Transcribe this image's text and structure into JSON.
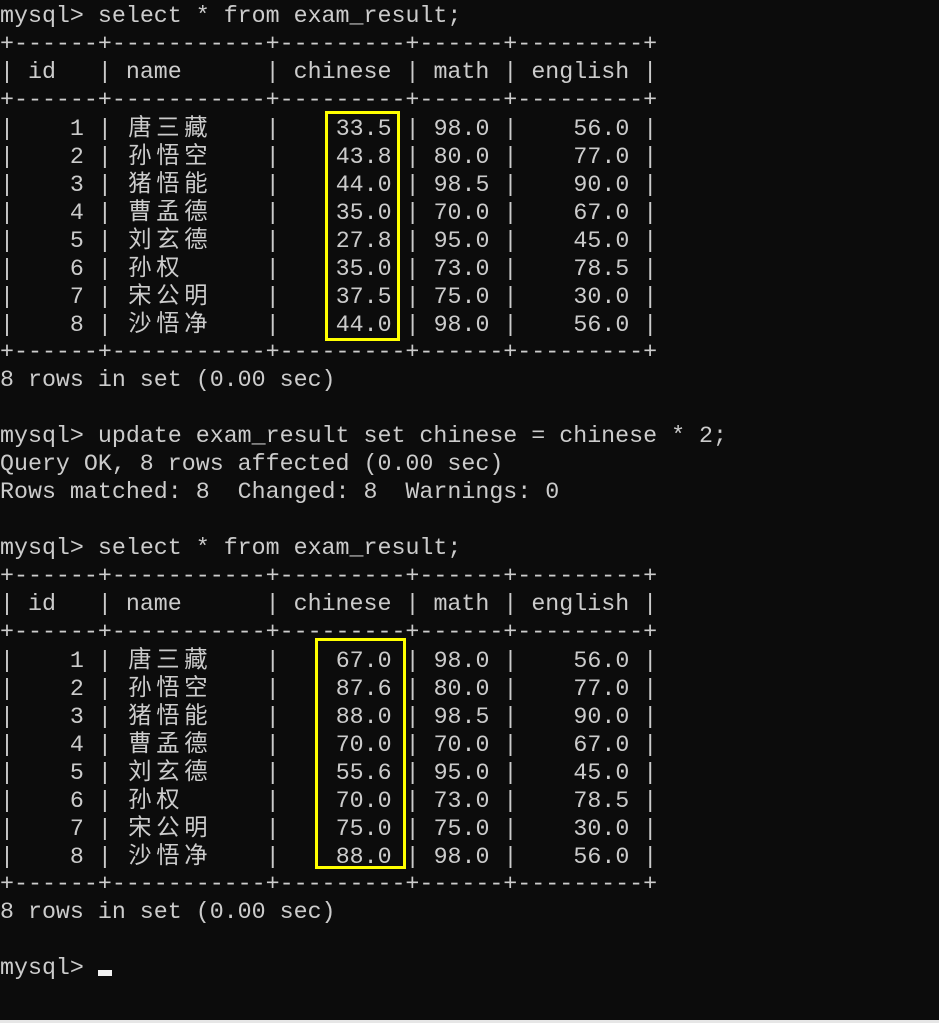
{
  "colors": {
    "background": "#0c0c0c",
    "text": "#cccccc",
    "highlight": "#ffff00"
  },
  "prompt": "mysql> ",
  "commands": {
    "select1": "select * from exam_result;",
    "update": "update exam_result set chinese = chinese * 2;",
    "select2": "select * from exam_result;"
  },
  "columns": [
    "id",
    "name",
    "chinese",
    "math",
    "english"
  ],
  "before": [
    {
      "id": "1",
      "name": "唐三藏",
      "chinese": "33.5",
      "math": "98.0",
      "english": "56.0"
    },
    {
      "id": "2",
      "name": "孙悟空",
      "chinese": "43.8",
      "math": "80.0",
      "english": "77.0"
    },
    {
      "id": "3",
      "name": "猪悟能",
      "chinese": "44.0",
      "math": "98.5",
      "english": "90.0"
    },
    {
      "id": "4",
      "name": "曹孟德",
      "chinese": "35.0",
      "math": "70.0",
      "english": "67.0"
    },
    {
      "id": "5",
      "name": "刘玄德",
      "chinese": "27.8",
      "math": "95.0",
      "english": "45.0"
    },
    {
      "id": "6",
      "name": "孙权",
      "chinese": "35.0",
      "math": "73.0",
      "english": "78.5"
    },
    {
      "id": "7",
      "name": "宋公明",
      "chinese": "37.5",
      "math": "75.0",
      "english": "30.0"
    },
    {
      "id": "8",
      "name": "沙悟净",
      "chinese": "44.0",
      "math": "98.0",
      "english": "56.0"
    }
  ],
  "after": [
    {
      "id": "1",
      "name": "唐三藏",
      "chinese": "67.0",
      "math": "98.0",
      "english": "56.0"
    },
    {
      "id": "2",
      "name": "孙悟空",
      "chinese": "87.6",
      "math": "80.0",
      "english": "77.0"
    },
    {
      "id": "3",
      "name": "猪悟能",
      "chinese": "88.0",
      "math": "98.5",
      "english": "90.0"
    },
    {
      "id": "4",
      "name": "曹孟德",
      "chinese": "70.0",
      "math": "70.0",
      "english": "67.0"
    },
    {
      "id": "5",
      "name": "刘玄德",
      "chinese": "55.6",
      "math": "95.0",
      "english": "45.0"
    },
    {
      "id": "6",
      "name": "孙权",
      "chinese": "70.0",
      "math": "73.0",
      "english": "78.5"
    },
    {
      "id": "7",
      "name": "宋公明",
      "chinese": "75.0",
      "math": "75.0",
      "english": "30.0"
    },
    {
      "id": "8",
      "name": "沙悟净",
      "chinese": "88.0",
      "math": "98.0",
      "english": "56.0"
    }
  ],
  "messages": {
    "rows_in_set_1": "8 rows in set (0.00 sec)",
    "query_ok": "Query OK, 8 rows affected (0.00 sec)",
    "rows_matched": "Rows matched: 8  Changed: 8  Warnings: 0",
    "rows_in_set_2": "8 rows in set (0.00 sec)"
  }
}
